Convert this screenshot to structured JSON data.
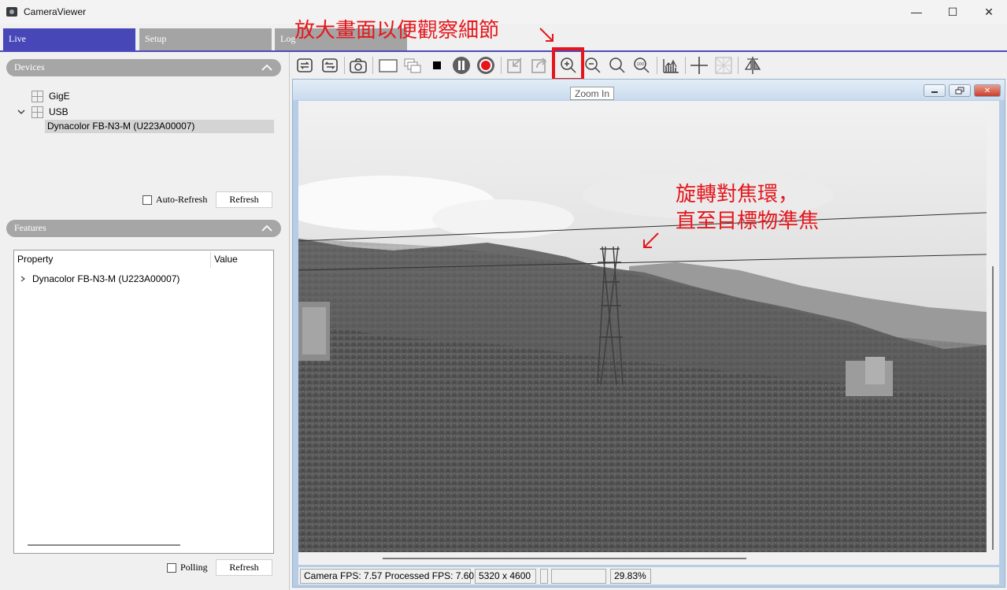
{
  "window": {
    "title": "CameraViewer",
    "minimize": "—",
    "maximize": "☐",
    "close": "✕"
  },
  "tabs": [
    {
      "label": "Live"
    },
    {
      "label": "Setup"
    },
    {
      "label": "Log"
    }
  ],
  "devices": {
    "header": "Devices",
    "items": [
      {
        "label": "GigE"
      },
      {
        "label": "USB"
      }
    ],
    "selected": "Dynacolor FB-N3-M (U223A00007)",
    "auto_refresh_label": "Auto-Refresh",
    "refresh_label": "Refresh"
  },
  "features": {
    "header": "Features",
    "col_property": "Property",
    "col_value": "Value",
    "row": "Dynacolor FB-N3-M (U223A00007)",
    "polling_label": "Polling",
    "refresh_label": "Refresh"
  },
  "toolbar": {
    "icons": [
      "connect-icon",
      "disconnect-icon",
      "snapshot-icon",
      "single-view-icon",
      "multi-view-icon",
      "stop-icon",
      "pause-icon",
      "record-icon",
      "import-icon",
      "export-icon",
      "zoom-in-icon",
      "zoom-out-icon",
      "zoom-fit-icon",
      "zoom-100-icon",
      "histogram-icon",
      "crosshair-icon",
      "grid-icon",
      "flip-icon"
    ],
    "tooltip": "Zoom In"
  },
  "annotations": {
    "top": "放大畫面以便觀察細節",
    "side_line1": "旋轉對焦環，",
    "side_line2": "直至目標物準焦",
    "color": "#e5171c"
  },
  "status": {
    "fps": "Camera FPS: 7.57 Processed FPS: 7.60",
    "resolution": "5320 x 4600",
    "blank1": "",
    "blank2": "",
    "zoom": "29.83%"
  }
}
